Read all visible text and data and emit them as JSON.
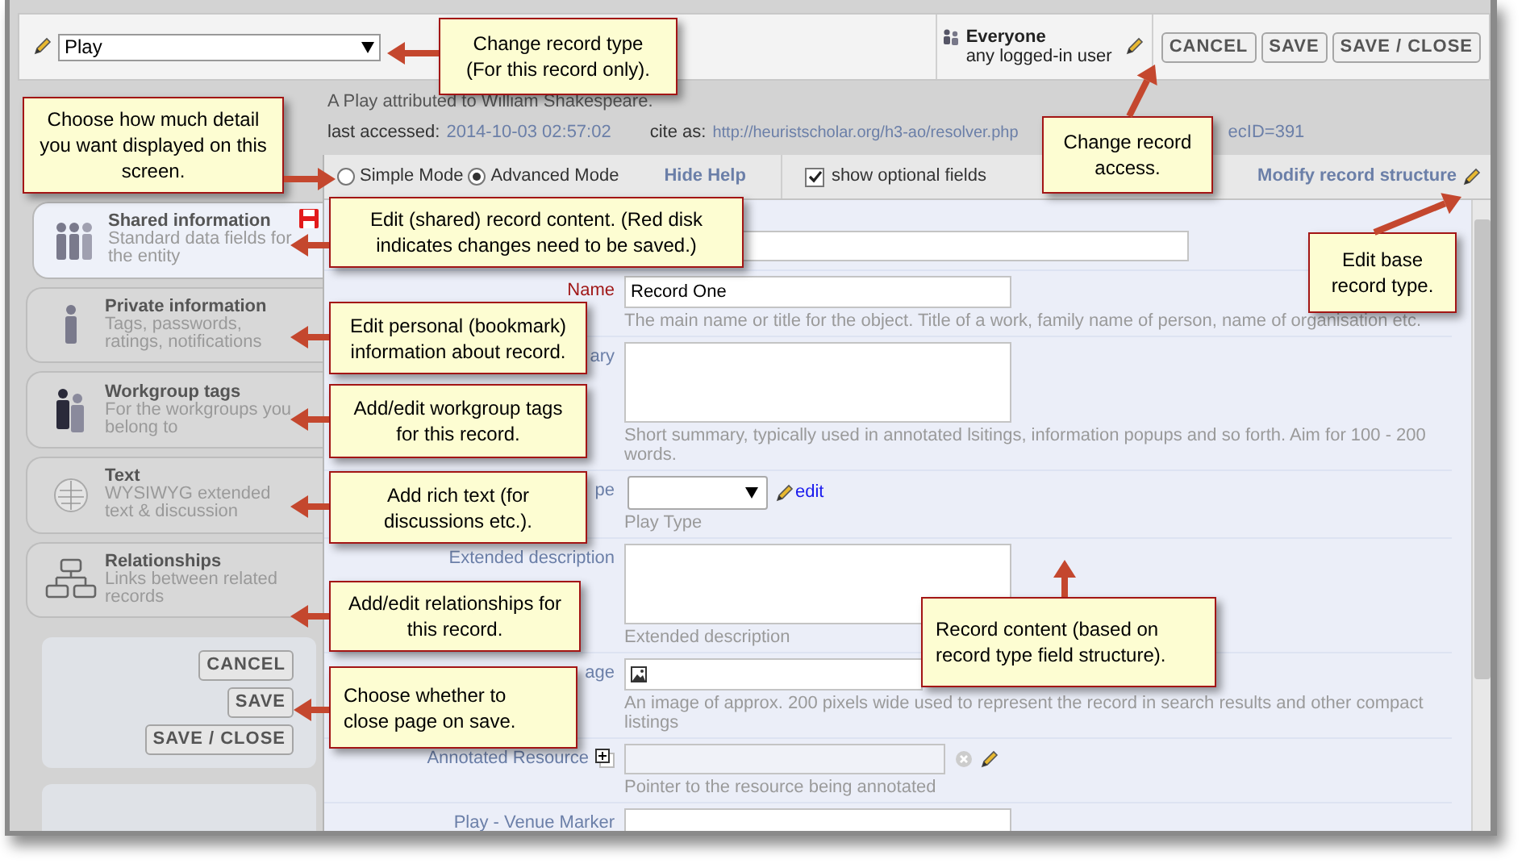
{
  "record_type_select": {
    "value": "Play"
  },
  "access": {
    "group": "Everyone",
    "detail": "any logged-in user"
  },
  "top_buttons": [
    "CANCEL",
    "SAVE",
    "SAVE / CLOSE"
  ],
  "record_info": {
    "description": "A Play attributed to William Shakespeare.",
    "last_accessed_label": "last accessed:",
    "last_accessed": "2014-10-03 02:57:02",
    "cite_label": "cite as:",
    "cite_url_start": "http://heuristscholar.org/h3-ao/resolver.php",
    "cite_url_end": "ecID=391"
  },
  "toolbar": {
    "modes": [
      {
        "label": "Simple Mode",
        "selected": false
      },
      {
        "label": "Advanced Mode",
        "selected": true
      }
    ],
    "help_link": "Hide Help",
    "optional_fields": {
      "label": "show optional fields",
      "checked": true
    },
    "modify_link": "Modify record structure"
  },
  "sidebar": {
    "tabs": [
      {
        "kind": "shared",
        "title": "Shared information",
        "subtitle": "Standard data fields for the entity",
        "selected": true,
        "unsaved": true
      },
      {
        "kind": "private",
        "title": "Private information",
        "subtitle": "Tags, passwords, ratings, notifications",
        "selected": false,
        "unsaved": false
      },
      {
        "kind": "workgroup",
        "title": "Workgroup tags",
        "subtitle": "For the workgroups you belong to",
        "selected": false,
        "unsaved": false
      },
      {
        "kind": "text",
        "title": "Text",
        "subtitle": "WYSIWYG extended text & discussion",
        "selected": false,
        "unsaved": false
      },
      {
        "kind": "relationships",
        "title": "Relationships",
        "subtitle": "Links between related records",
        "selected": false,
        "unsaved": false
      }
    ],
    "buttons": [
      "CANCEL",
      "SAVE",
      "SAVE / CLOSE"
    ]
  },
  "fields": [
    {
      "kind": "wide_text"
    },
    {
      "kind": "text",
      "label": "Name",
      "required": true,
      "value": "Record One",
      "help": "The main name or title for the object. Title of a work, family name of person, name of organisation etc."
    },
    {
      "kind": "textarea",
      "label": "ary",
      "required": false,
      "help": "Short summary, typically used in annotated lsitings, information popups and so forth. Aim for 100 - 200 words."
    },
    {
      "kind": "select",
      "label": "pe",
      "required": false,
      "action": "edit",
      "help": "Play Type"
    },
    {
      "kind": "textarea",
      "label": "Extended description",
      "required": false,
      "help": "Extended description"
    },
    {
      "kind": "image",
      "label": "age",
      "required": false,
      "help": "An image of approx. 200 pixels wide used to represent the record in search results and other compact listings"
    },
    {
      "kind": "pointer",
      "label": "Annotated Resource",
      "required": false,
      "help": "Pointer to the resource being annotated"
    },
    {
      "kind": "text",
      "label": "Play - Venue Marker",
      "required": false
    }
  ],
  "callouts": [
    {
      "text": "Change record type (For this record only)."
    },
    {
      "text": "Choose how much detail you want displayed on this screen."
    },
    {
      "text": "Change record access."
    },
    {
      "text": "Edit (shared) record content. (Red disk indicates changes need to be saved.)"
    },
    {
      "text": "Edit base record type."
    },
    {
      "text": "Edit personal (bookmark) information about record."
    },
    {
      "text": "Add/edit workgroup tags for this record."
    },
    {
      "text": "Add rich text (for discussions etc.)."
    },
    {
      "text": "Add/edit relationships for this record."
    },
    {
      "text": "Choose whether to close page on save."
    },
    {
      "text": "Record content (based on record type field structure)."
    }
  ]
}
